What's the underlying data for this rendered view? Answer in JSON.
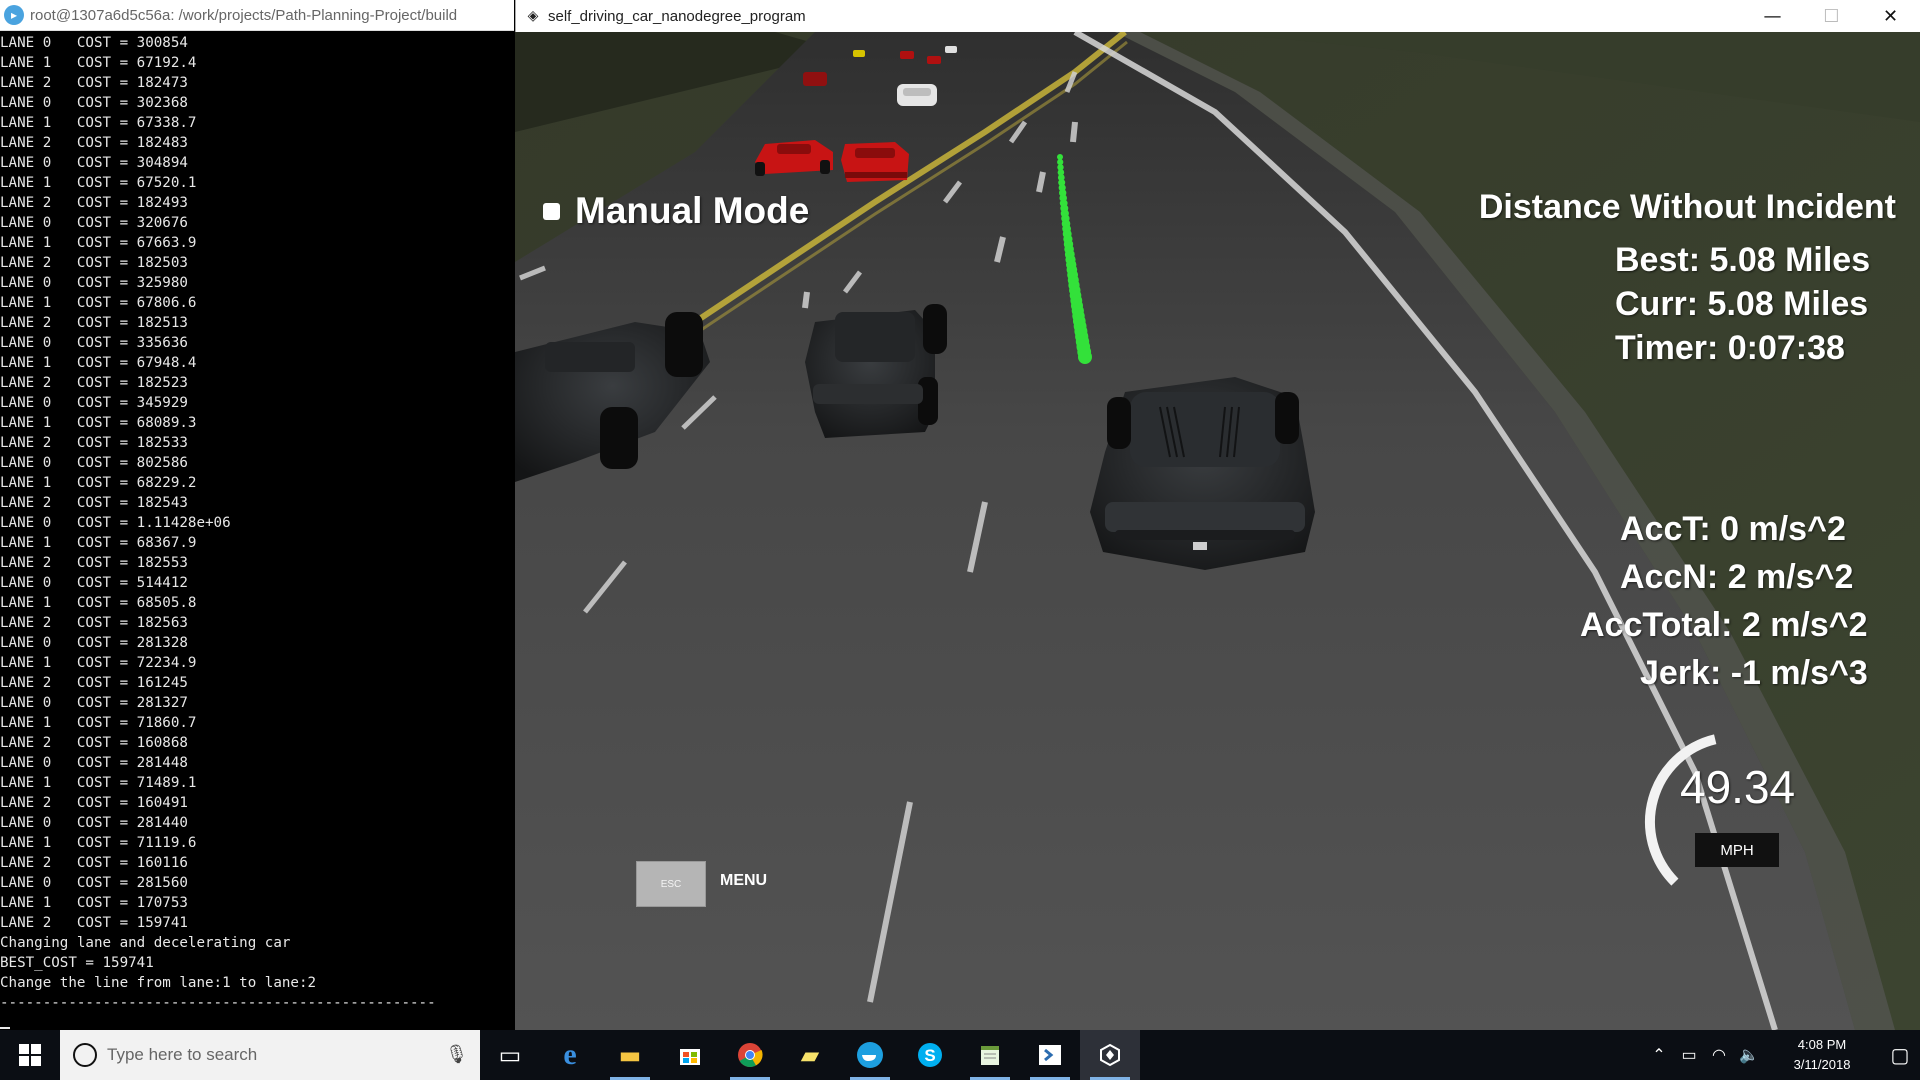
{
  "terminal": {
    "title": "root@1307a6d5c56a: /work/projects/Path-Planning-Project/build",
    "lines": [
      "LANE 0   COST = 300854",
      "LANE 1   COST = 67192.4",
      "LANE 2   COST = 182473",
      "LANE 0   COST = 302368",
      "LANE 1   COST = 67338.7",
      "LANE 2   COST = 182483",
      "LANE 0   COST = 304894",
      "LANE 1   COST = 67520.1",
      "LANE 2   COST = 182493",
      "LANE 0   COST = 320676",
      "LANE 1   COST = 67663.9",
      "LANE 2   COST = 182503",
      "LANE 0   COST = 325980",
      "LANE 1   COST = 67806.6",
      "LANE 2   COST = 182513",
      "LANE 0   COST = 335636",
      "LANE 1   COST = 67948.4",
      "LANE 2   COST = 182523",
      "LANE 0   COST = 345929",
      "LANE 1   COST = 68089.3",
      "LANE 2   COST = 182533",
      "LANE 0   COST = 802586",
      "LANE 1   COST = 68229.2",
      "LANE 2   COST = 182543",
      "LANE 0   COST = 1.11428e+06",
      "LANE 1   COST = 68367.9",
      "LANE 2   COST = 182553",
      "LANE 0   COST = 514412",
      "LANE 1   COST = 68505.8",
      "LANE 2   COST = 182563",
      "LANE 0   COST = 281328",
      "LANE 1   COST = 72234.9",
      "LANE 2   COST = 161245",
      "LANE 0   COST = 281327",
      "LANE 1   COST = 71860.7",
      "LANE 2   COST = 160868",
      "LANE 0   COST = 281448",
      "LANE 1   COST = 71489.1",
      "LANE 2   COST = 160491",
      "LANE 0   COST = 281440",
      "LANE 1   COST = 71119.6",
      "LANE 2   COST = 160116",
      "LANE 0   COST = 281560",
      "LANE 1   COST = 170753",
      "LANE 2   COST = 159741",
      "Changing lane and decelerating car",
      "BEST_COST = 159741",
      "Change the line from lane:1 to lane:2",
      "---------------------------------------------------"
    ]
  },
  "simulator": {
    "title": "self_driving_car_nanodegree_program",
    "window_buttons": {
      "minimize": "—",
      "maximize": "☐",
      "close": "✕"
    },
    "manual_mode_label": "Manual Mode",
    "distance_title": "Distance Without Incident",
    "best": "Best: 5.08 Miles",
    "curr": "Curr: 5.08 Miles",
    "timer": "Timer: 0:07:38",
    "acct": "AccT: 0 m/s^2",
    "accn": "AccN: 2 m/s^2",
    "acctotal": "AccTotal: 2 m/s^2",
    "jerk": "Jerk: -1 m/s^3",
    "speed": "49.34",
    "speed_unit": "MPH",
    "speed_gauge_fraction": 0.45,
    "esc_key": "ESC",
    "menu_label": "MENU"
  },
  "taskbar": {
    "search_placeholder": "Type here to search",
    "apps": [
      "task-view-icon",
      "edge-icon",
      "file-explorer-icon",
      "store-icon",
      "chrome-icon",
      "sticky-notes-icon",
      "docker-icon",
      "skype-icon",
      "notepad-icon",
      "remote-desktop-icon",
      "unity-icon"
    ],
    "clock_time": "4:08 PM",
    "clock_date": "3/11/2018"
  },
  "colors": {
    "path_green": "#33e13a",
    "lane_yellow": "#c8b43a",
    "road_gray": "#4a4a4a",
    "grass": "#2d3322",
    "red_car": "#c81414"
  }
}
